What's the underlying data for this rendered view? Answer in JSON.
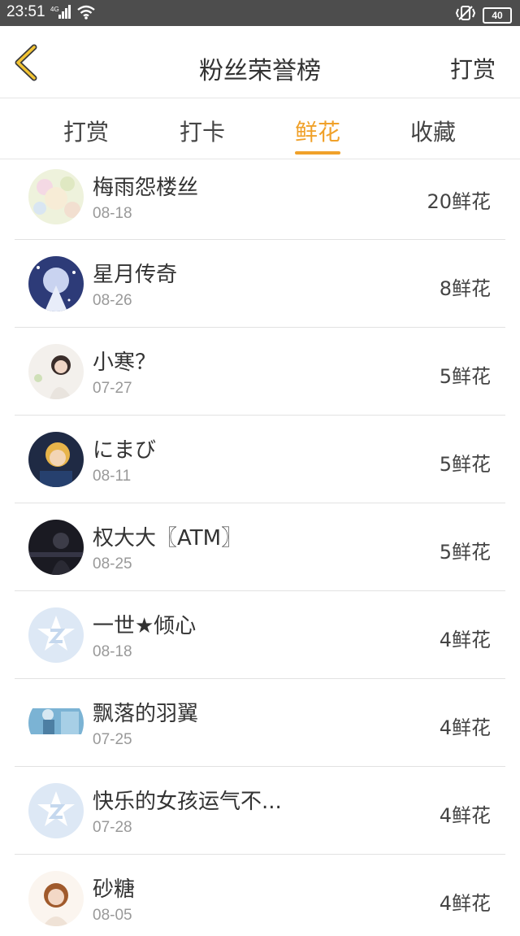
{
  "status_bar": {
    "time": "23:51",
    "network": "4G",
    "battery": "40"
  },
  "header": {
    "title": "粉丝荣誉榜",
    "action_label": "打赏"
  },
  "tabs": [
    {
      "label": "打赏",
      "active": false
    },
    {
      "label": "打卡",
      "active": false
    },
    {
      "label": "鲜花",
      "active": true
    },
    {
      "label": "收藏",
      "active": false
    }
  ],
  "colors": {
    "accent": "#f0a12a",
    "status_bar": "#4d4d4d"
  },
  "fans": [
    {
      "name": "梅雨怨楼丝",
      "date": "08-18",
      "count": "20鲜花",
      "avatar": "avatar-floral-girl"
    },
    {
      "name": "星月传奇",
      "date": "08-26",
      "count": "8鲜花",
      "avatar": "avatar-starry-princess"
    },
    {
      "name": "小寒？",
      "date": "07-27",
      "count": "5鲜花",
      "avatar": "avatar-girl-photo"
    },
    {
      "name": "にまび",
      "date": "08-11",
      "count": "5鲜花",
      "avatar": "avatar-cartoon"
    },
    {
      "name": "权大大〖ATM〗",
      "date": "08-25",
      "count": "5鲜花",
      "avatar": "avatar-dark-photo"
    },
    {
      "name": "一世★倾心",
      "date": "08-18",
      "count": "4鲜花",
      "avatar": "avatar-default-qzone"
    },
    {
      "name": "飘落的羽翼",
      "date": "07-25",
      "count": "4鲜花",
      "avatar": "avatar-blue-photo"
    },
    {
      "name": "快乐的女孩运气不...",
      "date": "07-28",
      "count": "4鲜花",
      "avatar": "avatar-default-qzone"
    },
    {
      "name": "砂糖",
      "date": "08-05",
      "count": "4鲜花",
      "avatar": "avatar-woman-photo"
    }
  ]
}
